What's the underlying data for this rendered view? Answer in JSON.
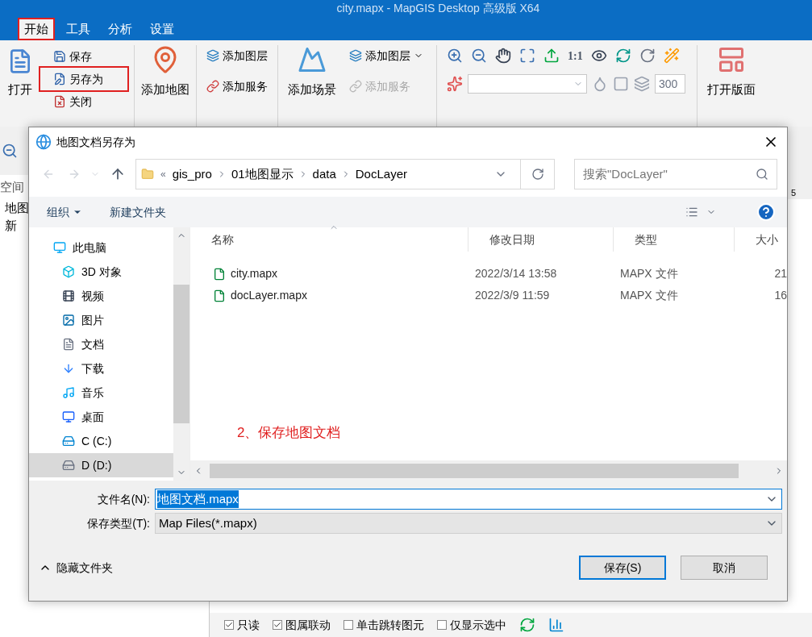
{
  "app": {
    "title": "city.mapx - MapGIS Desktop 高级版 X64",
    "tabs": [
      {
        "label": "开始",
        "selected": true,
        "highlighted": true
      },
      {
        "label": "工具",
        "selected": false,
        "highlighted": false
      },
      {
        "label": "分析",
        "selected": false,
        "highlighted": false
      },
      {
        "label": "设置",
        "selected": false,
        "highlighted": false
      }
    ],
    "ribbon": {
      "file_group": {
        "large": "打开",
        "items": [
          {
            "label": "保存",
            "highlighted": false
          },
          {
            "label": "另存为",
            "highlighted": true
          },
          {
            "label": "关闭",
            "highlighted": false
          }
        ]
      },
      "map_group": {
        "large": "添加地图",
        "items": [
          {
            "label": "添加图层",
            "dropdown": false,
            "disabled": false
          },
          {
            "label": "添加服务",
            "dropdown": false,
            "disabled": false
          }
        ]
      },
      "scene_group": {
        "large": "添加场景",
        "items": [
          {
            "label": "添加图层",
            "dropdown": true,
            "disabled": false
          },
          {
            "label": "添加服务",
            "dropdown": false,
            "disabled": true
          }
        ]
      },
      "tools_group": {
        "scale_label": "1:1",
        "number_value": "300"
      },
      "layout_group": {
        "large": "打开版面"
      }
    },
    "side_panel": {
      "title": "空间",
      "items": [
        "地图",
        "新"
      ]
    },
    "ruler_label": "5",
    "bottom_bar": {
      "checkboxes": [
        {
          "label": "只读",
          "checked": true
        },
        {
          "label": "图属联动",
          "checked": true
        },
        {
          "label": "单击跳转图元",
          "checked": false
        },
        {
          "label": "仅显示选中",
          "checked": false
        }
      ]
    }
  },
  "dialog": {
    "title": "地图文档另存为",
    "address": {
      "overflow": "«",
      "path": [
        "gis_pro",
        "01地图显示",
        "data",
        "DocLayer"
      ]
    },
    "search": {
      "placeholder": "搜索\"DocLayer\""
    },
    "toolbar": [
      {
        "label": "组织",
        "dropdown": true
      },
      {
        "label": "新建文件夹",
        "dropdown": false
      }
    ],
    "nav": [
      {
        "label": "此电脑",
        "kind": "computer",
        "selected": false,
        "children": [
          {
            "label": "3D 对象",
            "kind": "cube",
            "selected": false
          },
          {
            "label": "视频",
            "kind": "video",
            "selected": false
          },
          {
            "label": "图片",
            "kind": "pictures",
            "selected": false
          },
          {
            "label": "文档",
            "kind": "documents",
            "selected": false
          },
          {
            "label": "下载",
            "kind": "downloads",
            "selected": false
          },
          {
            "label": "音乐",
            "kind": "music",
            "selected": false
          },
          {
            "label": "桌面",
            "kind": "desktop",
            "selected": false
          },
          {
            "label": "C (C:)",
            "kind": "system_drive",
            "selected": false
          },
          {
            "label": "D (D:)",
            "kind": "drive",
            "selected": true
          }
        ]
      }
    ],
    "table": {
      "columns": [
        "名称",
        "修改日期",
        "类型",
        "大小"
      ],
      "rows": [
        {
          "name": "city.mapx",
          "modified": "2022/3/14 13:58",
          "type": "MAPX 文件",
          "size": "21"
        },
        {
          "name": "docLayer.mapx",
          "modified": "2022/3/9 11:59",
          "type": "MAPX 文件",
          "size": "16"
        }
      ]
    },
    "annotation": "2、保存地图文档",
    "file_name": {
      "label": "文件名(N):",
      "value": "地图文档.mapx"
    },
    "file_type": {
      "label": "保存类型(T):",
      "value": "Map Files(*.mapx)"
    },
    "hide_folders": "隐藏文件夹",
    "buttons": [
      {
        "label": "保存(S)",
        "primary": true
      },
      {
        "label": "取消",
        "primary": false
      }
    ]
  }
}
